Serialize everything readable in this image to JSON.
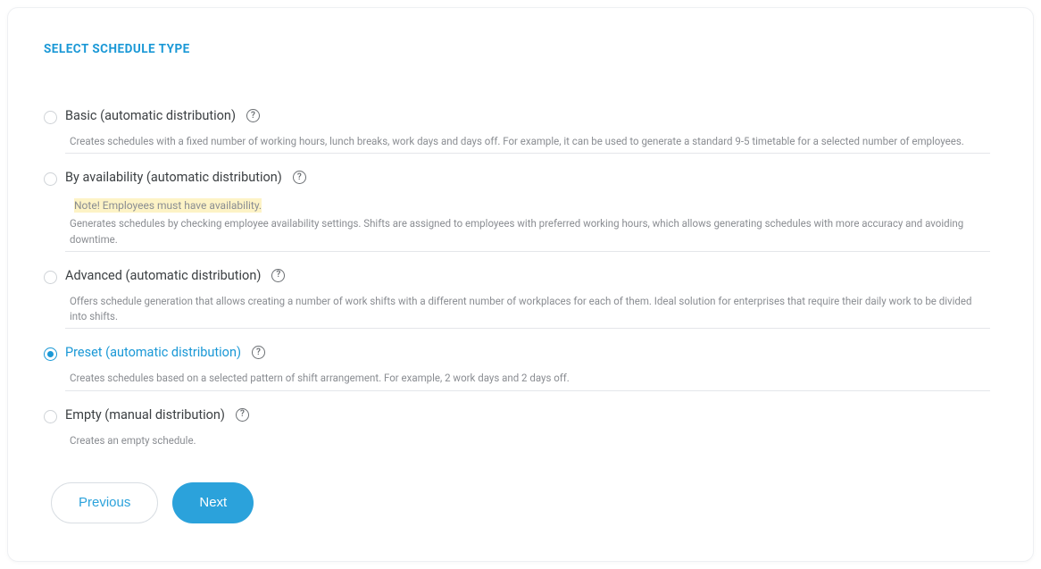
{
  "heading": "SELECT SCHEDULE TYPE",
  "options": [
    {
      "label": "Basic (automatic distribution)",
      "description": "Creates schedules with a fixed number of working hours, lunch breaks, work days and days off. For example, it can be used to generate a standard 9-5 timetable for a selected number of employees.",
      "selected": false
    },
    {
      "label": "By availability (automatic distribution)",
      "note": "Note! Employees must have availability.",
      "description": "Generates schedules by checking employee availability settings. Shifts are assigned to employees with preferred working hours, which allows generating schedules with more accuracy and avoiding downtime.",
      "selected": false
    },
    {
      "label": "Advanced (automatic distribution)",
      "description": "Offers schedule generation that allows creating a number of work shifts with a different number of workplaces for each of them. Ideal solution for enterprises that require their daily work to be divided into shifts.",
      "selected": false
    },
    {
      "label": "Preset (automatic distribution)",
      "description": "Creates schedules based on a selected pattern of shift arrangement. For example, 2 work days and 2 days off.",
      "selected": true
    },
    {
      "label": "Empty (manual distribution)",
      "description": "Creates an empty schedule.",
      "selected": false
    }
  ],
  "buttons": {
    "previous": "Previous",
    "next": "Next"
  }
}
